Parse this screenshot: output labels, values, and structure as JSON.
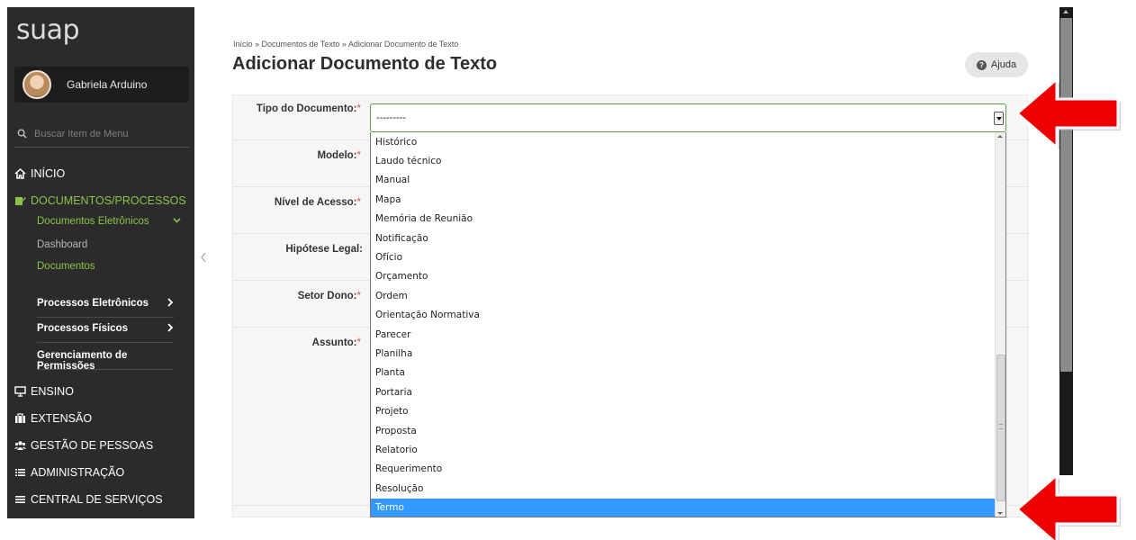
{
  "app": {
    "logo": "suap"
  },
  "user": {
    "name": "Gabriela Arduino"
  },
  "search": {
    "placeholder": "Buscar Item de Menu"
  },
  "sidebar": {
    "inicio": "INÍCIO",
    "documentos": "DOCUMENTOS/PROCESSOS",
    "documentos_eletronicos": "Documentos Eletrônicos",
    "dashboard": "Dashboard",
    "documentos_sub": "Documentos",
    "processos_eletronicos": "Processos Eletrônicos",
    "processos_fisicos": "Processos Físicos",
    "gerenciamento": "Gerenciamento de Permissões",
    "ensino": "ENSINO",
    "extensao": "EXTENSÃO",
    "gestao": "GESTÃO DE PESSOAS",
    "administracao": "ADMINISTRAÇÃO",
    "central": "CENTRAL DE SERVIÇOS"
  },
  "breadcrumb": "Início » Documentos de Texto » Adicionar Documento de Texto",
  "page_title": "Adicionar Documento de Texto",
  "help_button": "Ajuda",
  "form": {
    "tipo": "Tipo do Documento:",
    "modelo": "Modelo:",
    "nivel": "Nível de Acesso:",
    "hipotese": "Hipótese Legal:",
    "setor": "Setor Dono:",
    "assunto": "Assunto:",
    "required_mark": "*"
  },
  "select": {
    "value": "---------",
    "options": [
      "Histórico",
      "Laudo técnico",
      "Manual",
      "Mapa",
      "Memória de Reunião",
      "Notificação",
      "Ofício",
      "Orçamento",
      "Ordem",
      "Orientação Normativa",
      "Parecer",
      "Planilha",
      "Planta",
      "Portaria",
      "Projeto",
      "Proposta",
      "Relatorio",
      "Requerimento",
      "Resolução",
      "Termo"
    ],
    "selected": "Termo"
  },
  "colors": {
    "sidebar": "#2b2b2b",
    "accent_green": "#8bc34a",
    "selection": "#3399ff",
    "arrow": "#ee0000"
  },
  "icons": [
    "search-icon",
    "home-icon",
    "documents-icon",
    "chevron-down-icon",
    "chevron-right-icon",
    "ensino-icon",
    "extensao-icon",
    "pessoas-icon",
    "administracao-icon",
    "central-icon",
    "help-icon",
    "red-arrow"
  ]
}
